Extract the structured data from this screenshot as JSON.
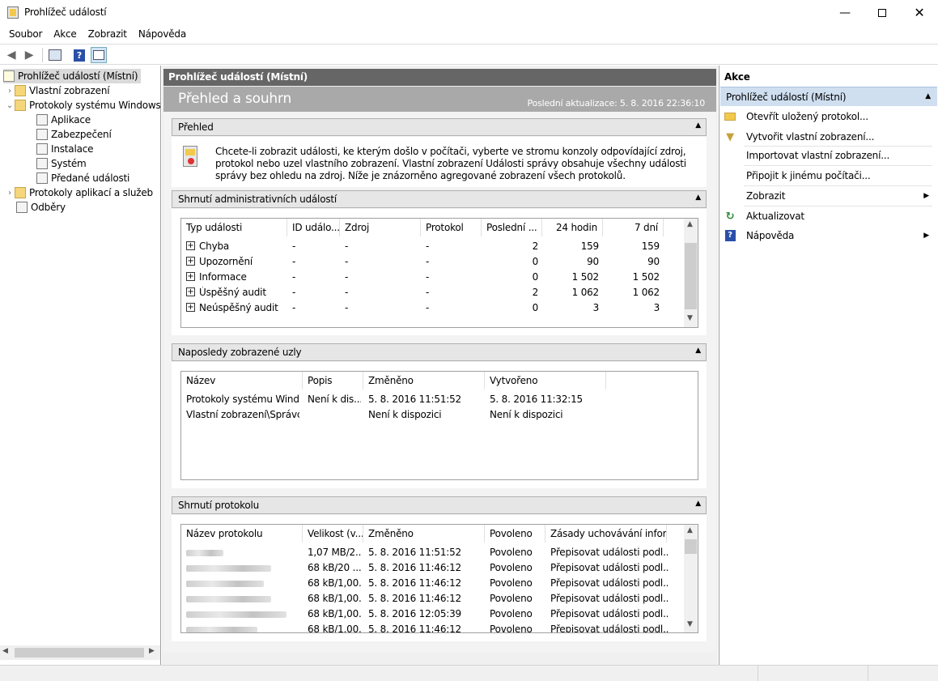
{
  "window": {
    "title": "Prohlížeč událostí"
  },
  "menu": [
    "Soubor",
    "Akce",
    "Zobrazit",
    "Nápověda"
  ],
  "tree": {
    "root": "Prohlížeč událostí (Místní)",
    "custom_views": "Vlastní zobrazení",
    "windows_logs": "Protokoly systému Windows",
    "logs": [
      "Aplikace",
      "Zabezpečení",
      "Instalace",
      "Systém",
      "Předané události"
    ],
    "app_logs": "Protokoly aplikací a služeb",
    "subscriptions": "Odběry"
  },
  "center": {
    "header": "Prohlížeč událostí (Místní)",
    "title": "Přehled a souhrn",
    "last_update": "Poslední aktualizace: 5. 8. 2016 22:36:10",
    "overview": {
      "title": "Přehled",
      "text": "Chcete-li zobrazit události, ke kterým došlo v počítači, vyberte ve stromu konzoly odpovídající zdroj, protokol nebo uzel vlastního zobrazení. Vlastní zobrazení Události správy obsahuje všechny události správy bez ohledu na zdroj. Níže je znázorněno agregované zobrazení všech protokolů."
    },
    "admin_summary": {
      "title": "Shrnutí administrativních událostí",
      "headers": [
        "Typ události",
        "ID událo...",
        "Zdroj",
        "Protokol",
        "Poslední ...",
        "24 hodin",
        "7 dní"
      ],
      "rows": [
        [
          "Chyba",
          "-",
          "-",
          "-",
          "2",
          "159",
          "159"
        ],
        [
          "Upozornění",
          "-",
          "-",
          "-",
          "0",
          "90",
          "90"
        ],
        [
          "Informace",
          "-",
          "-",
          "-",
          "0",
          "1 502",
          "1 502"
        ],
        [
          "Úspěšný audit",
          "-",
          "-",
          "-",
          "2",
          "1 062",
          "1 062"
        ],
        [
          "Neúspěšný audit",
          "-",
          "-",
          "-",
          "0",
          "3",
          "3"
        ]
      ]
    },
    "recent_nodes": {
      "title": "Naposledy zobrazené uzly",
      "headers": [
        "Název",
        "Popis",
        "Změněno",
        "Vytvořeno"
      ],
      "rows": [
        [
          "Protokoly systému Wind...",
          "Není k dis...",
          "5. 8. 2016 11:51:52",
          "5. 8. 2016 11:32:15"
        ],
        [
          "Vlastní zobrazení\\Správc...",
          "",
          "Není k dispozici",
          "Není k dispozici"
        ]
      ]
    },
    "log_summary": {
      "title": "Shrnutí protokolu",
      "headers": [
        "Název protokolu",
        "Velikost (v...",
        "Změněno",
        "Povoleno",
        "Zásady uchovávání infor..."
      ],
      "rows": [
        [
          "1,07 MB/2...",
          "5. 8. 2016 11:51:52",
          "Povoleno",
          "Přepisovat události podl..."
        ],
        [
          "68 kB/20 ...",
          "5. 8. 2016 11:46:12",
          "Povoleno",
          "Přepisovat události podl..."
        ],
        [
          "68 kB/1,00...",
          "5. 8. 2016 11:46:12",
          "Povoleno",
          "Přepisovat události podl..."
        ],
        [
          "68 kB/1,00...",
          "5. 8. 2016 11:46:12",
          "Povoleno",
          "Přepisovat události podl..."
        ],
        [
          "68 kB/1,00...",
          "5. 8. 2016 12:05:39",
          "Povoleno",
          "Přepisovat události podl..."
        ],
        [
          "68 kB/1,00...",
          "5. 8. 2016 11:46:12",
          "Povoleno",
          "Přepisovat události podl..."
        ]
      ]
    }
  },
  "actions": {
    "title": "Akce",
    "group": "Prohlížeč událostí (Místní)",
    "items": [
      "Otevřít uložený protokol...",
      "Vytvořit vlastní zobrazení...",
      "Importovat vlastní zobrazení...",
      "Připojit k jinému počítači...",
      "Zobrazit",
      "Aktualizovat",
      "Nápověda"
    ]
  }
}
